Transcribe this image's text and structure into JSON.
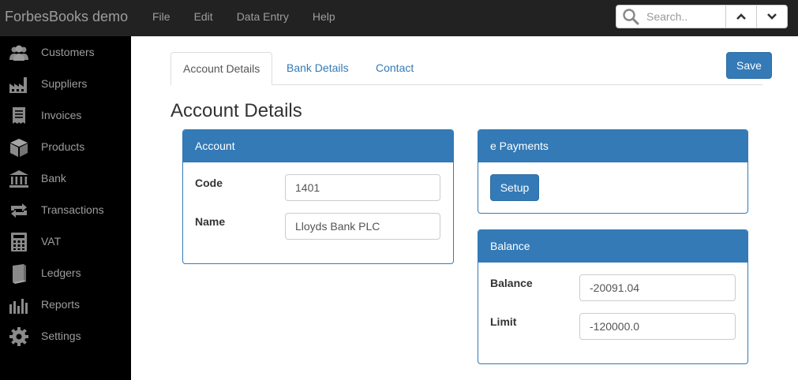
{
  "app": {
    "brand": "ForbesBooks demo"
  },
  "menu": [
    {
      "label": "File"
    },
    {
      "label": "Edit"
    },
    {
      "label": "Data Entry"
    },
    {
      "label": "Help"
    }
  ],
  "search": {
    "placeholder": "Search..",
    "icon": "search-icon",
    "prev_icon": "chevron-up-icon",
    "next_icon": "chevron-down-icon"
  },
  "sidebar": {
    "items": [
      {
        "label": "Customers",
        "icon": "users-icon"
      },
      {
        "label": "Suppliers",
        "icon": "factory-icon"
      },
      {
        "label": "Invoices",
        "icon": "receipt-icon"
      },
      {
        "label": "Products",
        "icon": "box-icon"
      },
      {
        "label": "Bank",
        "icon": "bank-icon"
      },
      {
        "label": "Transactions",
        "icon": "retweet-icon"
      },
      {
        "label": "VAT",
        "icon": "calculator-icon"
      },
      {
        "label": "Ledgers",
        "icon": "book-icon"
      },
      {
        "label": "Reports",
        "icon": "bar-chart-icon"
      },
      {
        "label": "Settings",
        "icon": "gear-icon"
      }
    ]
  },
  "tabs": [
    {
      "label": "Account Details",
      "active": true
    },
    {
      "label": "Bank Details",
      "active": false
    },
    {
      "label": "Contact",
      "active": false
    }
  ],
  "toolbar": {
    "save_label": "Save"
  },
  "page": {
    "title": "Account Details"
  },
  "account_panel": {
    "heading": "Account",
    "code_label": "Code",
    "code_value": "1401",
    "name_label": "Name",
    "name_value": "Lloyds Bank PLC"
  },
  "epayments_panel": {
    "heading": "e Payments",
    "setup_label": "Setup"
  },
  "balance_panel": {
    "heading": "Balance",
    "balance_label": "Balance",
    "balance_value": "-20091.04",
    "limit_label": "Limit",
    "limit_value": "-120000.0"
  },
  "colors": {
    "navbar_bg": "#222222",
    "sidebar_bg": "#000000",
    "nav_text": "#9d9d9d",
    "primary": "#337ab7",
    "link": "#337ab7"
  }
}
